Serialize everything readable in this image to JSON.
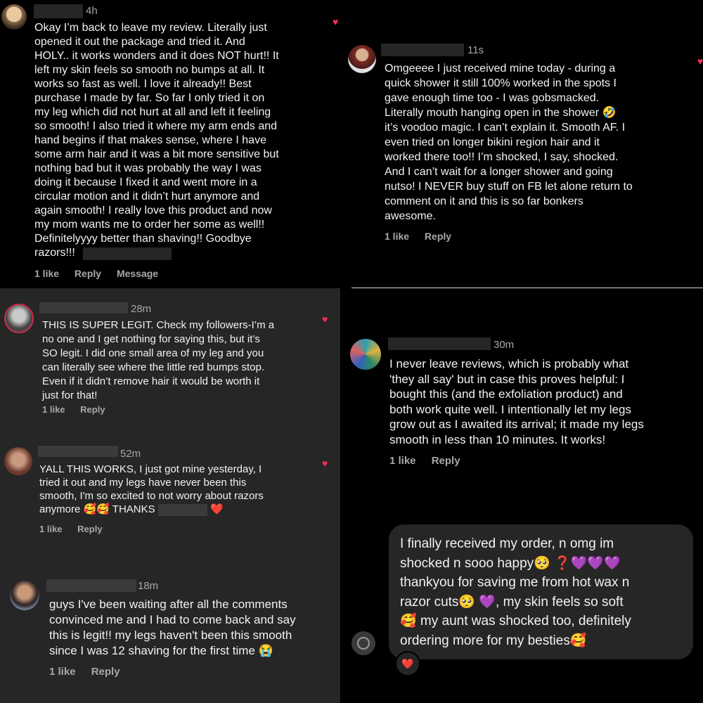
{
  "p1": {
    "time": "4h",
    "text": "Okay I’m back to leave my review. Literally just\nopened it out the package and tried it. And\nHOLY.. it works wonders and it does NOT hurt!! It\nleft my skin feels so smooth no bumps at all. It\nworks so fast as well. I love it already!! Best\npurchase I made by far. So far I only tried it on\nmy leg which did not hurt at all and left it feeling\nso smooth! I also tried it where my arm ends and\nhand begins if that makes sense, where I have\nsome arm hair and it was a bit more sensitive but\nnothing bad but it was probably the way I was\ndoing it because I fixed it and went more in a\ncircular motion and it didn’t hurt anymore and\nagain smooth! I really love this product and now\nmy mom wants me to order her some as well!!\nDefinitelyyyy better than shaving!! Goodbye\nrazors!!!",
    "likes": "1 like",
    "reply": "Reply",
    "message": "Message",
    "heart": "♥"
  },
  "p2": {
    "time": "11s",
    "text": "Omgeeee I just received mine today - during a\nquick shower it still 100% worked in the spots I\ngave enough time too - I was gobsmacked.\nLiterally mouth hanging open in the shower 🤣\nit’s voodoo magic. I can’t explain it. Smooth AF. I\neven tried on longer bikini region hair and it\nworked there too!! I’m shocked, I say, shocked.\nAnd I can’t wait for a longer shower and going\nnutso! I NEVER buy stuff on FB let alone return to\ncomment on it and this is so far bonkers\nawesome.",
    "likes": "1 like",
    "reply": "Reply"
  },
  "p3a": {
    "time": "28m",
    "text": "THIS IS SUPER LEGIT. Check my followers-I’m a\nno one and I get nothing for saying this, but it’s\nSO legit. I did one small area of my leg and you\ncan literally see where the little red bumps stop.\nEven if it didn’t remove hair it would be worth it\njust for that!",
    "likes": "1 like",
    "reply": "Reply",
    "heart": "♥"
  },
  "p3b": {
    "time": "52m",
    "text": "YALL THIS WORKS, I just got mine yesterday, I\ntried it out and my legs have never been this\nsmooth, I'm so excited to not worry about razors\nanymore 🥰🥰 THANKS",
    "trail": "❤️",
    "likes": "1 like",
    "reply": "Reply",
    "heart": "♥"
  },
  "p3c": {
    "time": "18m",
    "text": "guys I've been waiting after all the comments\nconvinced me and I had to come back and say\nthis is legit!! my legs haven't been this smooth\nsince I was 12 shaving for the first time 😭",
    "likes": "1 like",
    "reply": "Reply"
  },
  "p4": {
    "time": "30m",
    "text": "I never leave reviews, which is probably what\n'they all say' but in case this proves helpful: I\nbought this (and the exfoliation product) and\nboth work quite well. I intentionally let my legs\ngrow out as I awaited its arrival; it made my legs\nsmooth in less than 10 minutes. It works!",
    "likes": "1 like",
    "reply": "Reply"
  },
  "p5": {
    "text": "I finally received my order, n omg im\nshocked n sooo happy🥺 ❓💜💜💜\nthankyou for saving me from hot wax n\nrazor cuts🥺 💜, my skin feels so soft\n🥰 my aunt was shocked too, definitely\nordering more for my besties🥰",
    "reaction": "❤️"
  }
}
